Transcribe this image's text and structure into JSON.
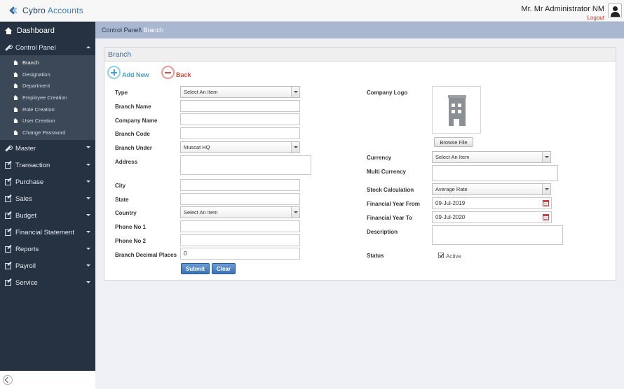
{
  "header": {
    "brand_part1": "Cybro",
    "brand_part2": "Accounts",
    "user_name": "Mr. Mr Administrator NM",
    "logout_label": "Logout"
  },
  "sidebar": {
    "dashboard": "Dashboard",
    "control_panel": "Control Panel",
    "control_panel_items": [
      "Branch",
      "Designation",
      "Department",
      "Employee Creation",
      "Role Creation",
      "User Creation",
      "Change Password"
    ],
    "menu": [
      "Master",
      "Transaction",
      "Purchase",
      "Sales",
      "Budget",
      "Financial Statement",
      "Reports",
      "Payroll",
      "Service"
    ]
  },
  "breadcrumb": {
    "parent": "Control Panel\\",
    "current": " Branch"
  },
  "panel": {
    "title": "Branch",
    "add_new": "Add New",
    "back": "Back"
  },
  "form_left": {
    "type_label": "Type",
    "type_value": "Select An Item",
    "branch_name_label": "Branch Name",
    "company_name_label": "Company Name",
    "branch_code_label": "Branch Code",
    "branch_under_label": "Branch Under",
    "branch_under_value": "Muscat HQ",
    "address_label": "Address",
    "city_label": "City",
    "state_label": "State",
    "country_label": "Country",
    "country_value": "Select An Item",
    "phone1_label": "Phone No 1",
    "phone2_label": "Phone No 2",
    "decimal_label": "Branch Decimal Places",
    "decimal_value": "0",
    "submit": "Submit",
    "clear": "Clear"
  },
  "form_right": {
    "logo_label": "Company Logo",
    "browse": "Browse File",
    "currency_label": "Currency",
    "currency_value": "Select An Item",
    "multi_currency_label": "Multi Currency",
    "stock_calc_label": "Stock Calculation",
    "stock_calc_value": "Average Rate",
    "fy_from_label": "Financial Year From",
    "fy_from_value": "09-Jul-2019",
    "fy_to_label": "Financial Year To",
    "fy_to_value": "09-Jul-2020",
    "description_label": "Description",
    "status_label": "Status",
    "active_label": "Active",
    "active_checked": true
  }
}
